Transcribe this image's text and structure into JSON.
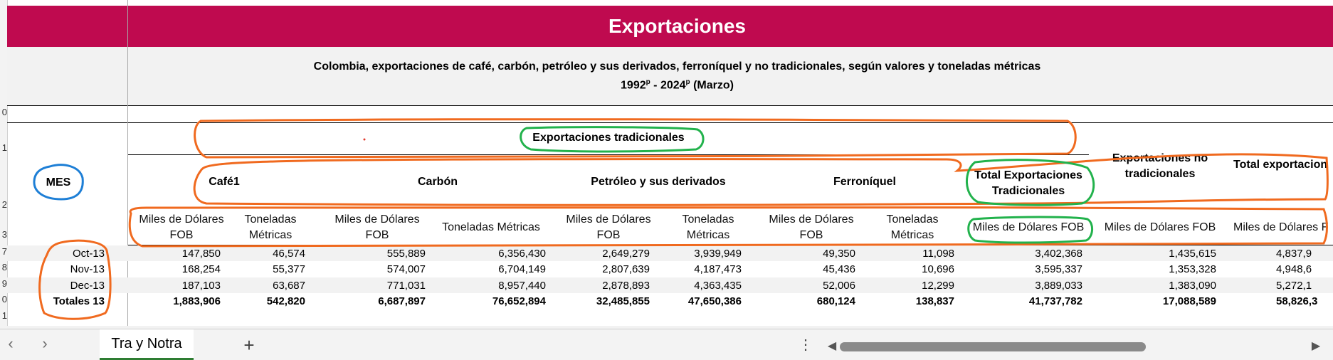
{
  "sheet": {
    "banner_title": "Exportaciones",
    "subtitle_line1": "Colombia, exportaciones de café, carbón, petróleo y sus derivados,  ferroníquel y no tradicionales,  según valores y toneladas métricas",
    "subtitle_year_start": "1992",
    "subtitle_sup1": "p",
    "subtitle_sep": " - 2024",
    "subtitle_sup2": "p",
    "subtitle_tail": " (Marzo)"
  },
  "header": {
    "mes": "MES",
    "trad_group": "Exportaciones tradicionales",
    "cafe": "Café1",
    "carbon": "Carbón",
    "petroleo": "Petróleo y sus derivados",
    "ferroniquel": "Ferroníquel",
    "total_trad_1": "Total Exportaciones",
    "total_trad_2": "Tradicionales",
    "no_trad_1": "Exportaciones no",
    "no_trad_2": "tradicionales",
    "total_exp": "Total exportacion",
    "sub_cafe_fob_1": "Miles de Dólares",
    "sub_cafe_fob_2": "FOB",
    "sub_cafe_ton_1": "Toneladas",
    "sub_cafe_ton_2": "Métricas",
    "sub_carbon_fob_1": "Miles de Dólares",
    "sub_carbon_fob_2": "FOB",
    "sub_carbon_ton": "Toneladas Métricas",
    "sub_pet_fob_1": "Miles de Dólares",
    "sub_pet_fob_2": "FOB",
    "sub_pet_ton_1": "Toneladas",
    "sub_pet_ton_2": "Métricas",
    "sub_fer_fob_1": "Miles de Dólares",
    "sub_fer_fob_2": "FOB",
    "sub_fer_ton_1": "Toneladas",
    "sub_fer_ton_2": "Métricas",
    "sub_total_trad": "Miles de Dólares FOB",
    "sub_no_trad": "Miles de Dólares FOB",
    "sub_total_exp": "Miles de Dólares F"
  },
  "row_numbers": [
    "0",
    "1",
    "2",
    "3",
    "7",
    "8",
    "9",
    "0",
    "1"
  ],
  "rows": [
    {
      "mes": "Oct-13",
      "bold": false,
      "values": [
        "147,850",
        "46,574",
        "555,889",
        "6,356,430",
        "2,649,279",
        "3,939,949",
        "49,350",
        "11,098",
        "3,402,368",
        "1,435,615",
        "4,837,9"
      ]
    },
    {
      "mes": "Nov-13",
      "bold": false,
      "values": [
        "168,254",
        "55,377",
        "574,007",
        "6,704,149",
        "2,807,639",
        "4,187,473",
        "45,436",
        "10,696",
        "3,595,337",
        "1,353,328",
        "4,948,6"
      ]
    },
    {
      "mes": "Dec-13",
      "bold": false,
      "values": [
        "187,103",
        "63,687",
        "771,031",
        "8,957,440",
        "2,878,893",
        "4,363,435",
        "52,006",
        "12,299",
        "3,889,033",
        "1,383,090",
        "5,272,1"
      ]
    },
    {
      "mes": "Totales 13",
      "bold": true,
      "values": [
        "1,883,906",
        "542,820",
        "6,687,897",
        "76,652,894",
        "32,485,855",
        "47,650,386",
        "680,124",
        "138,837",
        "41,737,782",
        "17,088,589",
        "58,826,3"
      ]
    }
  ],
  "tabs": {
    "nav_prev": "‹",
    "nav_next": "›",
    "sheet_name": "Tra y Notra",
    "add": "+",
    "more": "⋮",
    "scroll_left": "◀",
    "scroll_right": "▶"
  },
  "colors": {
    "banner": "#bf0a4f",
    "annotation_orange": "#f06a1f",
    "annotation_green": "#22b24c",
    "annotation_blue": "#1e7fd6",
    "annotation_yellow": "#f2c713"
  }
}
